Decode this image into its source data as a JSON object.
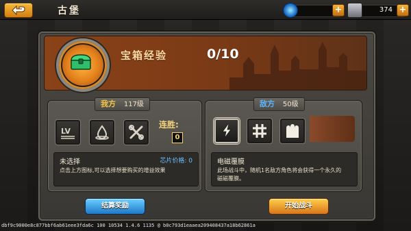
{
  "header": {
    "title": "古堡",
    "gems_value": "",
    "currency_value": "374"
  },
  "chest": {
    "label": "宝箱经验",
    "progress": "0/10",
    "progress_fraction": 0.0
  },
  "my_side": {
    "label": "我方",
    "level": "117级",
    "streak_label": "连胜:",
    "streak_value": "0",
    "desc_title": "未选择",
    "desc_price": "芯片价格: 0",
    "desc_text": "点击上方图标,可以选择想要购买的增益效果"
  },
  "enemy_side": {
    "label": "敌方",
    "level": "50级",
    "desc_title": "电磁覆膜",
    "desc_text_line1": "此场战斗中，随机1名敌方角色将会获得一个永久的",
    "desc_text_line2": "磁磁覆膜。"
  },
  "buttons": {
    "end_reward": "结算奖励",
    "start_battle": "开始战斗"
  },
  "debug_text": "dbf9c9000e8c877bbf6ab61eee3fda6c 100 10534 1.4.6 1135 @ b0c793d1eaaea209408437a18b62861a",
  "colors": {
    "accent_orange": "#d8761a",
    "accent_blue": "#1f78c8",
    "my_label": "#f4c64a",
    "enemy_label": "#5fb4ff"
  }
}
